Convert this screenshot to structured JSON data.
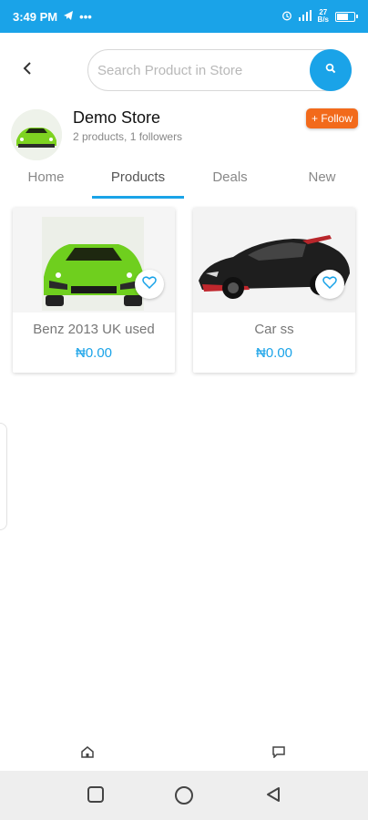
{
  "status_bar": {
    "time": "3:49 PM",
    "network_speed": "27\nB/s"
  },
  "search": {
    "placeholder": "Search Product in Store"
  },
  "store": {
    "name": "Demo Store",
    "meta": "2 products, 1 followers",
    "follow_label": "+ Follow"
  },
  "tabs": [
    {
      "label": "Home",
      "active": false
    },
    {
      "label": "Products",
      "active": true
    },
    {
      "label": "Deals",
      "active": false
    },
    {
      "label": "New",
      "active": false
    }
  ],
  "products": [
    {
      "title": "Benz 2013 UK used",
      "price": "₦0.00",
      "image": "green-sports-car"
    },
    {
      "title": "Car ss",
      "price": "₦0.00",
      "image": "black-sports-car"
    }
  ],
  "colors": {
    "accent": "#1aa3e8",
    "follow": "#f26a1b"
  },
  "icons": {
    "back": "chevron-left-icon",
    "search": "search-icon",
    "favorite": "heart-icon",
    "home": "home-icon",
    "chat": "chat-icon"
  }
}
